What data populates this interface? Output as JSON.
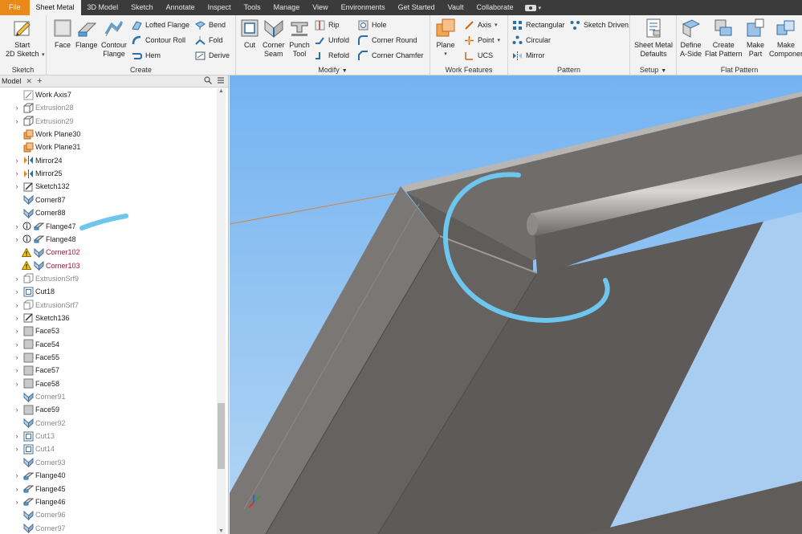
{
  "menu": {
    "tabs": [
      "File",
      "Sheet Metal",
      "3D Model",
      "Sketch",
      "Annotate",
      "Inspect",
      "Tools",
      "Manage",
      "View",
      "Environments",
      "Get Started",
      "Vault",
      "Collaborate"
    ],
    "active_tab": "Sheet Metal"
  },
  "ribbon": {
    "sketch": {
      "title": "Sketch",
      "start_2d_sketch": "Start\n2D Sketch"
    },
    "create": {
      "title": "Create",
      "face": "Face",
      "flange": "Flange",
      "contour_flange": "Contour\nFlange",
      "lofted_flange": "Lofted Flange",
      "contour_roll": "Contour Roll",
      "hem": "Hem",
      "bend": "Bend",
      "fold": "Fold",
      "derive": "Derive"
    },
    "modify": {
      "title": "Modify",
      "cut": "Cut",
      "corner_seam": "Corner\nSeam",
      "punch_tool": "Punch\nTool",
      "rip": "Rip",
      "unfold": "Unfold",
      "refold": "Refold",
      "hole": "Hole",
      "corner_round": "Corner Round",
      "corner_chamfer": "Corner Chamfer"
    },
    "work_features": {
      "title": "Work Features",
      "plane": "Plane",
      "axis": "Axis",
      "point": "Point",
      "ucs": "UCS"
    },
    "pattern": {
      "title": "Pattern",
      "rectangular": "Rectangular",
      "circular": "Circular",
      "mirror": "Mirror",
      "sketch_driven": "Sketch Driven"
    },
    "setup": {
      "title": "Setup",
      "sheet_metal_defaults": "Sheet Metal\nDefaults"
    },
    "flat_pattern": {
      "title": "Flat Pattern",
      "define_a_side": "Define\nA-Side",
      "create_flat_pattern": "Create\nFlat Pattern",
      "make_part": "Make\nPart",
      "make_components": "Make\nComponer"
    }
  },
  "browser": {
    "tab_label": "Model",
    "items": [
      {
        "label": "Work Axis7",
        "icon": "work-axis-icon",
        "expandable": false,
        "style": "normal"
      },
      {
        "label": "Extrusion28",
        "icon": "extrusion-icon",
        "expandable": true,
        "style": "gray"
      },
      {
        "label": "Extrusion29",
        "icon": "extrusion-icon",
        "expandable": true,
        "style": "gray"
      },
      {
        "label": "Work Plane30",
        "icon": "work-plane-icon",
        "expandable": false,
        "style": "normal"
      },
      {
        "label": "Work Plane31",
        "icon": "work-plane-icon",
        "expandable": false,
        "style": "normal"
      },
      {
        "label": "Mirror24",
        "icon": "mirror-icon",
        "expandable": true,
        "style": "normal"
      },
      {
        "label": "Mirror25",
        "icon": "mirror-icon",
        "expandable": true,
        "style": "normal"
      },
      {
        "label": "Sketch132",
        "icon": "sketch-icon",
        "expandable": true,
        "style": "normal"
      },
      {
        "label": "Corner87",
        "icon": "corner-icon",
        "expandable": false,
        "style": "normal"
      },
      {
        "label": "Corner88",
        "icon": "corner-icon",
        "expandable": false,
        "style": "normal"
      },
      {
        "label": "Flange47",
        "icon": "flange-icon",
        "expandable": true,
        "style": "normal",
        "flag": "info"
      },
      {
        "label": "Flange48",
        "icon": "flange-icon",
        "expandable": true,
        "style": "normal",
        "flag": "info"
      },
      {
        "label": "Corner102",
        "icon": "corner-icon",
        "expandable": false,
        "style": "red",
        "flag": "warning"
      },
      {
        "label": "Corner103",
        "icon": "corner-icon",
        "expandable": false,
        "style": "red",
        "flag": "warning"
      },
      {
        "label": "ExtrusionSrf9",
        "icon": "extrusion-surface-icon",
        "expandable": true,
        "style": "gray"
      },
      {
        "label": "Cut18",
        "icon": "cut-icon",
        "expandable": true,
        "style": "normal"
      },
      {
        "label": "ExtrusionSrf7",
        "icon": "extrusion-surface-icon",
        "expandable": true,
        "style": "gray"
      },
      {
        "label": "Sketch136",
        "icon": "sketch-icon",
        "expandable": true,
        "style": "normal"
      },
      {
        "label": "Face53",
        "icon": "face-icon",
        "expandable": true,
        "style": "normal"
      },
      {
        "label": "Face54",
        "icon": "face-icon",
        "expandable": true,
        "style": "normal"
      },
      {
        "label": "Face55",
        "icon": "face-icon",
        "expandable": true,
        "style": "normal"
      },
      {
        "label": "Face57",
        "icon": "face-icon",
        "expandable": true,
        "style": "normal"
      },
      {
        "label": "Face58",
        "icon": "face-icon",
        "expandable": true,
        "style": "normal"
      },
      {
        "label": "Corner91",
        "icon": "corner-icon",
        "expandable": false,
        "style": "gray"
      },
      {
        "label": "Face59",
        "icon": "face-icon",
        "expandable": true,
        "style": "normal"
      },
      {
        "label": "Corner92",
        "icon": "corner-icon",
        "expandable": false,
        "style": "gray"
      },
      {
        "label": "Cut13",
        "icon": "cut-icon",
        "expandable": true,
        "style": "gray"
      },
      {
        "label": "Cut14",
        "icon": "cut-icon",
        "expandable": true,
        "style": "gray"
      },
      {
        "label": "Corner93",
        "icon": "corner-icon",
        "expandable": false,
        "style": "gray"
      },
      {
        "label": "Flange40",
        "icon": "flange-icon",
        "expandable": true,
        "style": "normal"
      },
      {
        "label": "Flange45",
        "icon": "flange-icon",
        "expandable": true,
        "style": "normal"
      },
      {
        "label": "Flange46",
        "icon": "flange-icon",
        "expandable": true,
        "style": "normal"
      },
      {
        "label": "Corner96",
        "icon": "corner-icon",
        "expandable": false,
        "style": "gray"
      },
      {
        "label": "Corner97",
        "icon": "corner-icon",
        "expandable": false,
        "style": "gray"
      }
    ]
  },
  "colors": {
    "accent_orange": "#e8891a",
    "menubar_bg": "#3b3b3b",
    "sky_top": "#74b3f2",
    "sky_bottom": "#b4d6f3",
    "metal": "#6f6c6a",
    "annotation_blue": "#6ec6ee",
    "error_red": "#b0122b"
  }
}
